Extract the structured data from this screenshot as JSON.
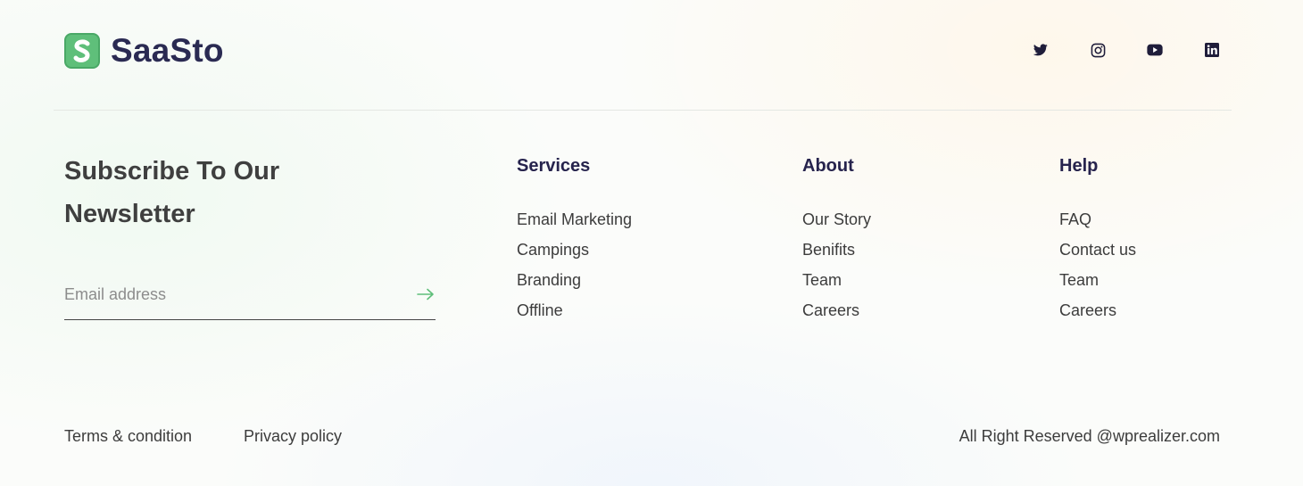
{
  "brand": {
    "name": "SaaSto",
    "logo_icon": "saasto-s-logo-icon",
    "accent": "#5fbf7a",
    "text_color": "#2a2a52"
  },
  "social": [
    {
      "name": "twitter-icon"
    },
    {
      "name": "instagram-icon"
    },
    {
      "name": "youtube-icon"
    },
    {
      "name": "linkedin-icon"
    }
  ],
  "newsletter": {
    "title": "Subscribe To Our Newsletter",
    "email_value": "",
    "email_placeholder": "Email address",
    "submit_icon": "arrow-right-icon"
  },
  "columns": [
    {
      "title": "Services",
      "links": [
        "Email Marketing",
        "Campings",
        "Branding",
        "Offline"
      ]
    },
    {
      "title": "About",
      "links": [
        "Our Story",
        "Benifits",
        "Team",
        "Careers"
      ]
    },
    {
      "title": "Help",
      "links": [
        "FAQ",
        "Contact us",
        "Team",
        "Careers"
      ]
    }
  ],
  "bottom": {
    "terms": "Terms & condition",
    "privacy": "Privacy policy",
    "copyright": "All Right Reserved @wprealizer.com"
  }
}
